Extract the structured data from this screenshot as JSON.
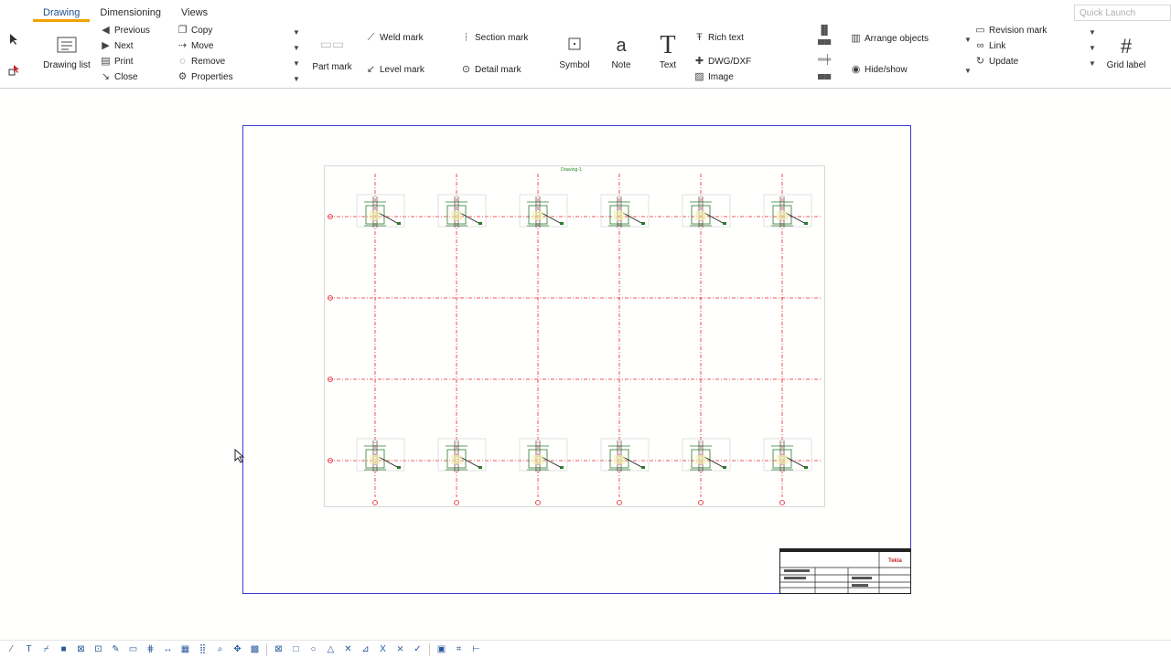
{
  "tabs": [
    {
      "label": "Drawing",
      "active": true
    },
    {
      "label": "Dimensioning",
      "active": false
    },
    {
      "label": "Views",
      "active": false
    }
  ],
  "quick_launch": {
    "placeholder": "Quick Launch"
  },
  "ribbon": {
    "drawing_list": "Drawing list",
    "nav": {
      "previous": "Previous",
      "next": "Next",
      "print": "Print",
      "close": "Close"
    },
    "edit": {
      "copy": "Copy",
      "move": "Move",
      "remove": "Remove",
      "properties": "Properties"
    },
    "part_mark": "Part mark",
    "weld_mark": "Weld mark",
    "level_mark": "Level mark",
    "section_mark": "Section mark",
    "detail_mark": "Detail mark",
    "symbol": "Symbol",
    "note": "Note",
    "note_glyph": "a",
    "text": "Text",
    "text_glyph": "T",
    "rich_text": "Rich text",
    "dwg_dxf": "DWG/DXF",
    "image": "Image",
    "arrange_objects": "Arrange objects",
    "hide_show": "Hide/show",
    "revision_mark": "Revision mark",
    "link": "Link",
    "update": "Update",
    "grid_label": "Grid label"
  },
  "drawing": {
    "title_stamp": "Drawing-1",
    "brand": "Tekla",
    "grid_columns": 6,
    "grid_rows": 4,
    "grid_color": "#e8212b",
    "sheet_border_color": "#3b3bd6"
  },
  "bottom_toolbar": {
    "icons": [
      "line-icon",
      "text-icon",
      "polyline-icon",
      "rectangle-fill-icon",
      "cross-box-icon",
      "zoom-icon",
      "pencil-icon",
      "frame-icon",
      "grid-icon",
      "dimension-icon",
      "hatch-icon",
      "grid-dots-icon",
      "magnify-icon",
      "pan-icon",
      "pattern-icon",
      "box-x-icon",
      "square-icon",
      "circle-icon",
      "triangle-icon",
      "x-icon",
      "snap-icon",
      "cut-icon",
      "cross-icon",
      "check-icon",
      "active-snap-icon",
      "ortho-icon",
      "measure-icon"
    ]
  }
}
